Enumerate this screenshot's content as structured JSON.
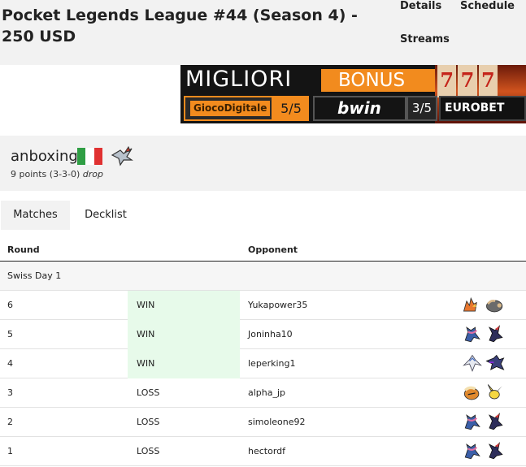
{
  "header": {
    "title": "Pocket Legends League #44 (Season 4) - 250 USD",
    "nav": {
      "details": "Details",
      "schedule": "Schedule",
      "streams": "Streams"
    }
  },
  "ad": {
    "headline": "MIGLIORI",
    "badge": "BONUS",
    "slot_digits": [
      "7",
      "7",
      "7"
    ],
    "operators": [
      {
        "name": "GiocoDigitale",
        "score": "5/5"
      },
      {
        "name": "bwin",
        "score": "3/5"
      },
      {
        "name": "EUROBET"
      }
    ]
  },
  "player": {
    "name": "anboxing",
    "flag": "italy-flag",
    "flag_colors": [
      "#2f9e44",
      "#ffffff",
      "#e03131"
    ],
    "sprite": "skarmory-sprite-icon",
    "record": "9 points (3-3-0)",
    "status": "drop"
  },
  "tabs": {
    "matches": "Matches",
    "decklist": "Decklist"
  },
  "colors": {
    "win_background": "#e7faea",
    "panel_gray": "#f2f2f2",
    "ad_orange": "#f28b1e"
  },
  "matches": {
    "headers": {
      "round": "Round",
      "opponent": "Opponent"
    },
    "section": "Swiss Day 1",
    "rows": [
      {
        "round": "6",
        "result": "WIN",
        "opponent": "Yukapower35",
        "deck_icons": [
          "charizard-sprite-icon",
          "donphan-sprite-icon"
        ]
      },
      {
        "round": "5",
        "result": "WIN",
        "opponent": "Joninha10",
        "deck_icons": [
          "greninja-sprite-icon",
          "weavile-sprite-icon"
        ]
      },
      {
        "round": "4",
        "result": "WIN",
        "opponent": "leperking1",
        "deck_icons": [
          "lugia-sprite-icon",
          "hydreigon-sprite-icon"
        ]
      },
      {
        "round": "3",
        "result": "LOSS",
        "opponent": "alpha_jp",
        "deck_icons": [
          "arcanine-sprite-icon",
          "pichu-sprite-icon"
        ]
      },
      {
        "round": "2",
        "result": "LOSS",
        "opponent": "simoleone92",
        "deck_icons": [
          "greninja-sprite-icon",
          "weavile-sprite-icon"
        ]
      },
      {
        "round": "1",
        "result": "LOSS",
        "opponent": "hectordf",
        "deck_icons": [
          "greninja-sprite-icon",
          "weavile-sprite-icon"
        ]
      }
    ]
  }
}
